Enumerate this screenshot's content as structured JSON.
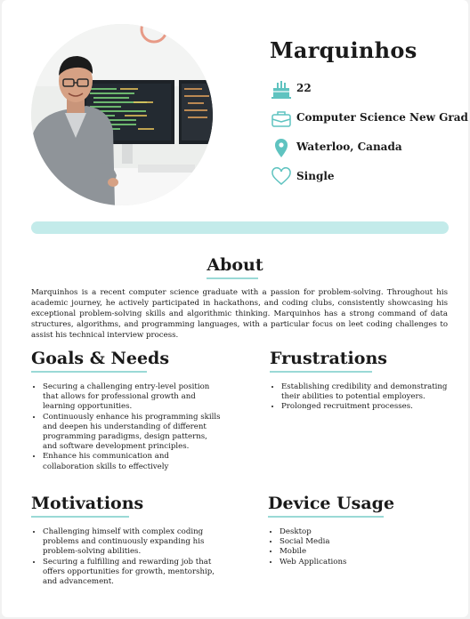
{
  "profile": {
    "name": "Marquinhos",
    "age": "22",
    "occupation": "Computer Science New Grad",
    "location": "Waterloo, Canada",
    "status": "Single"
  },
  "icons": {
    "age": "birthday-cake-icon",
    "occupation": "briefcase-icon",
    "location": "map-pin-icon",
    "status": "heart-icon"
  },
  "colors": {
    "accent": "#9ad9d6",
    "bar": "#c3ebea",
    "icon": "#5fc3c0"
  },
  "about": {
    "title": "About",
    "text": "Marquinhos is a recent computer science graduate with a passion for  problem-solving. Throughout his academic journey, he actively participated in hackathons, and coding clubs, consistently showcasing his exceptional problem-solving skills and algorithmic thinking. Marquinhos has a strong command of data structures, algorithms, and programming languages, with a particular focus on leet coding challenges to assist his technical interview process."
  },
  "goals": {
    "title": "Goals & Needs",
    "items": [
      "Securing a challenging entry-level position that allows for professional growth and learning opportunities.",
      "Continuously enhance his programming skills and deepen his understanding of different programming paradigms, design patterns, and software development principles.",
      "Enhance his communication and collaboration skills to effectively"
    ]
  },
  "frustrations": {
    "title": "Frustrations",
    "items": [
      "Establishing credibility and demonstrating their abilities to potential employers.",
      "Prolonged recruitment processes."
    ]
  },
  "motivations": {
    "title": "Motivations",
    "items": [
      "Challenging himself with complex coding problems and continuously expanding his problem-solving abilities.",
      "Securing a fulfilling and rewarding job that offers opportunities for growth, mentorship, and advancement."
    ]
  },
  "devices": {
    "title": "Device Usage",
    "items": [
      "Desktop",
      "Social Media",
      "Mobile",
      "Web Applications"
    ]
  }
}
